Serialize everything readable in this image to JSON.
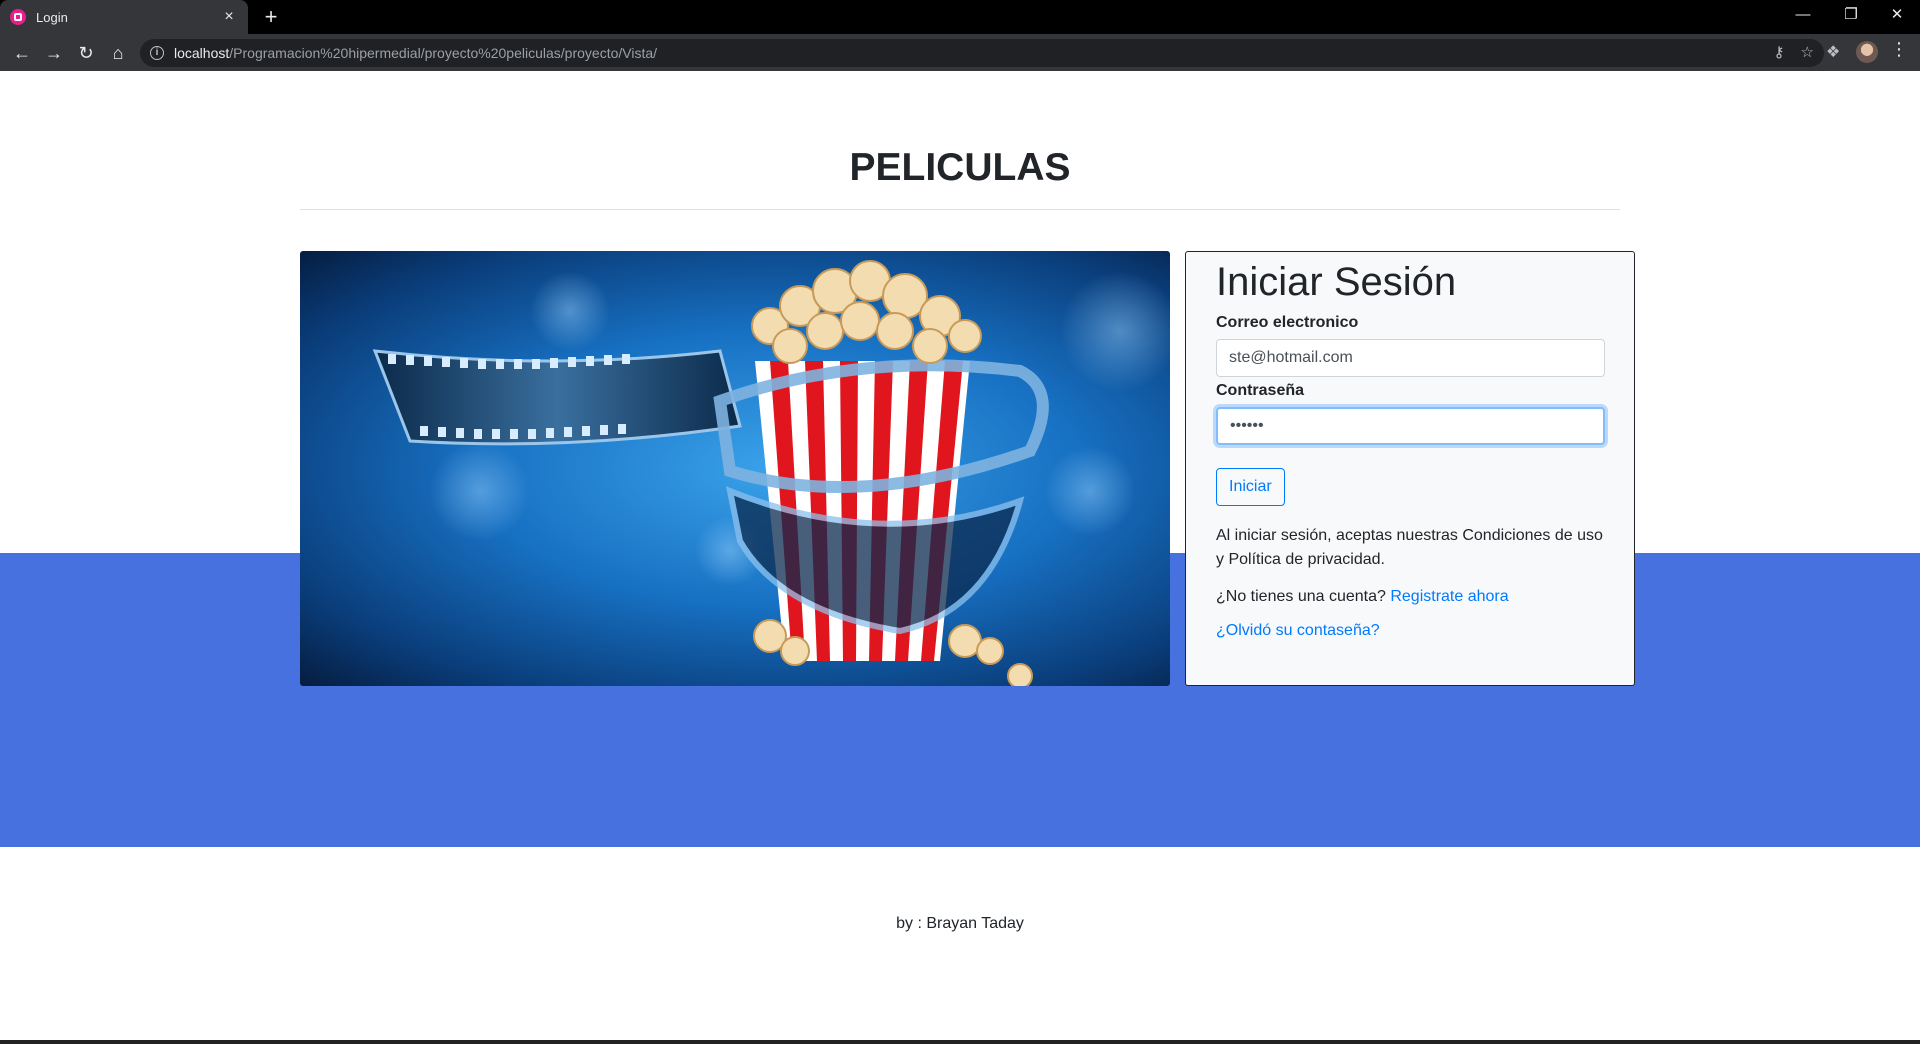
{
  "browser": {
    "tab_title": "Login",
    "tab_close": "×",
    "new_tab": "+",
    "url_host": "localhost",
    "url_path": "/Programacion%20hipermedial/proyecto%20peliculas/proyecto/Vista/"
  },
  "page": {
    "title": "PELICULAS",
    "login": {
      "heading": "Iniciar Sesión",
      "email_label": "Correo electronico",
      "email_value": "ste@hotmail.com",
      "password_label": "Contraseña",
      "password_value": "••••••",
      "submit_label": "Iniciar",
      "terms_text": "Al iniciar sesión, aceptas nuestras Condiciones de uso y Política de privacidad.",
      "signup_prompt": "¿No tienes una cuenta? ",
      "signup_link": "Registrate ahora",
      "forgot_link": "¿Olvidó su contaseña?"
    },
    "footer": "by : Brayan Taday"
  },
  "colors": {
    "band": "#4771df",
    "link": "#007bff"
  }
}
